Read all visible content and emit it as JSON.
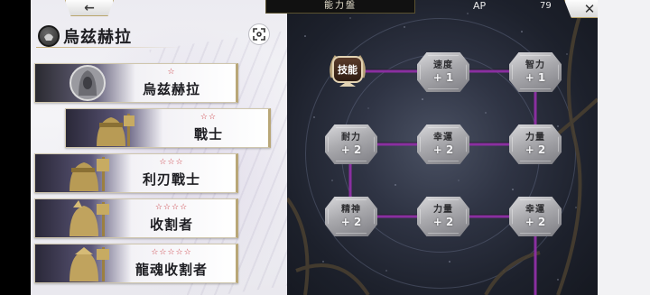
{
  "header": {
    "back_label": "←",
    "board_title": "能力盤",
    "ap_label": "AP",
    "ap_value": "79",
    "close_label": "✕"
  },
  "character": {
    "name": "烏兹赫拉",
    "emblem_icon": "helmet-emblem-icon",
    "expand_icon": "expand-icon"
  },
  "classes": [
    {
      "stars": "☆",
      "name": "烏兹赫拉",
      "selected": true
    },
    {
      "stars": "☆☆",
      "name": "戰士",
      "selected": false
    },
    {
      "stars": "☆☆☆",
      "name": "利刃戰士",
      "selected": false
    },
    {
      "stars": "☆☆☆☆",
      "name": "收割者",
      "selected": false
    },
    {
      "stars": "☆☆☆☆☆",
      "name": "龍魂收割者",
      "selected": false
    }
  ],
  "board": {
    "skill_label": "技能",
    "nodes": [
      {
        "name": "速度",
        "value": "+ 1"
      },
      {
        "name": "智力",
        "value": "+ 1"
      },
      {
        "name": "耐力",
        "value": "+ 2"
      },
      {
        "name": "幸運",
        "value": "+ 2"
      },
      {
        "name": "力量",
        "value": "+ 2"
      },
      {
        "name": "精神",
        "value": "+ 2"
      },
      {
        "name": "力量",
        "value": "+ 2"
      },
      {
        "name": "幸運",
        "value": "+ 2"
      }
    ]
  },
  "colors": {
    "path": "#8a2fa0",
    "star": "#c8333a",
    "gold": "#b9a778"
  }
}
